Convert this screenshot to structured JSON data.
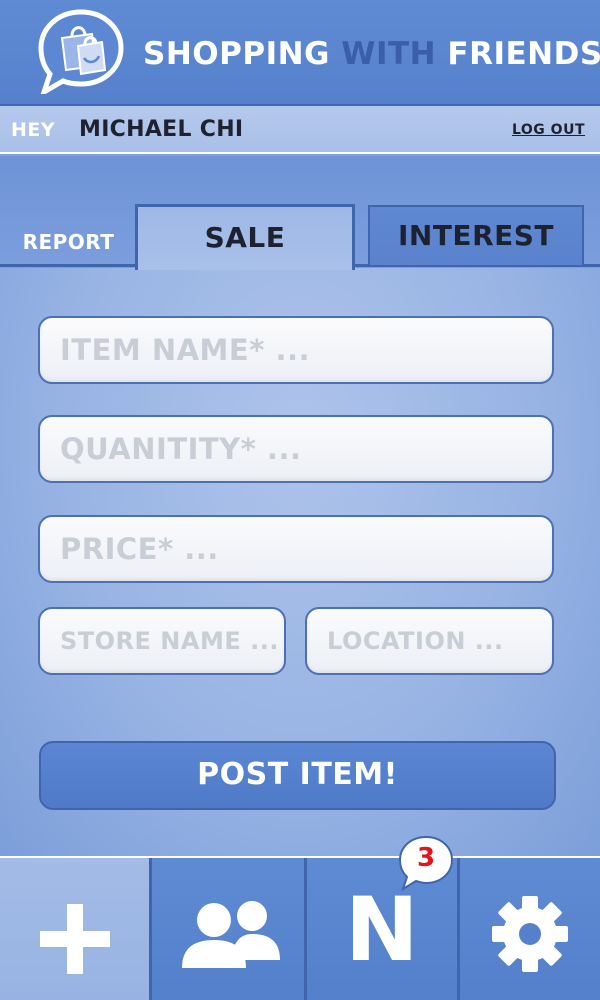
{
  "header": {
    "title_part1": "SHOPPING",
    "title_part2": "WITH",
    "title_part3": "FRIENDS",
    "logo_icon": "shopping-bag-speech-bubble-icon"
  },
  "userbar": {
    "greeting": "HEY",
    "username": "MICHAEL CHI",
    "logout_label": "LOG OUT"
  },
  "tabs": [
    {
      "label": "REPORT",
      "active": false
    },
    {
      "label": "SALE",
      "active": true
    },
    {
      "label": "INTEREST",
      "active": false
    }
  ],
  "form": {
    "item_name_placeholder": "ITEM NAME* ...",
    "quantity_placeholder": "QUANITITY* ...",
    "price_placeholder": "PRICE* ...",
    "store_name_placeholder": "STORE NAME ...",
    "location_placeholder": "LOCATION ...",
    "submit_label": "POST ITEM!"
  },
  "bottom_nav": {
    "items": [
      {
        "icon": "plus-icon",
        "active": true
      },
      {
        "icon": "friends-icon",
        "active": false
      },
      {
        "icon": "notifications-icon",
        "letter": "N",
        "badge": "3",
        "active": false
      },
      {
        "icon": "gear-icon",
        "active": false
      }
    ]
  },
  "colors": {
    "header_blue": "#5f8bd4",
    "dark_text": "#1e2230",
    "badge_red": "#e3141b",
    "highlight_blue": "#3a5fa8"
  }
}
